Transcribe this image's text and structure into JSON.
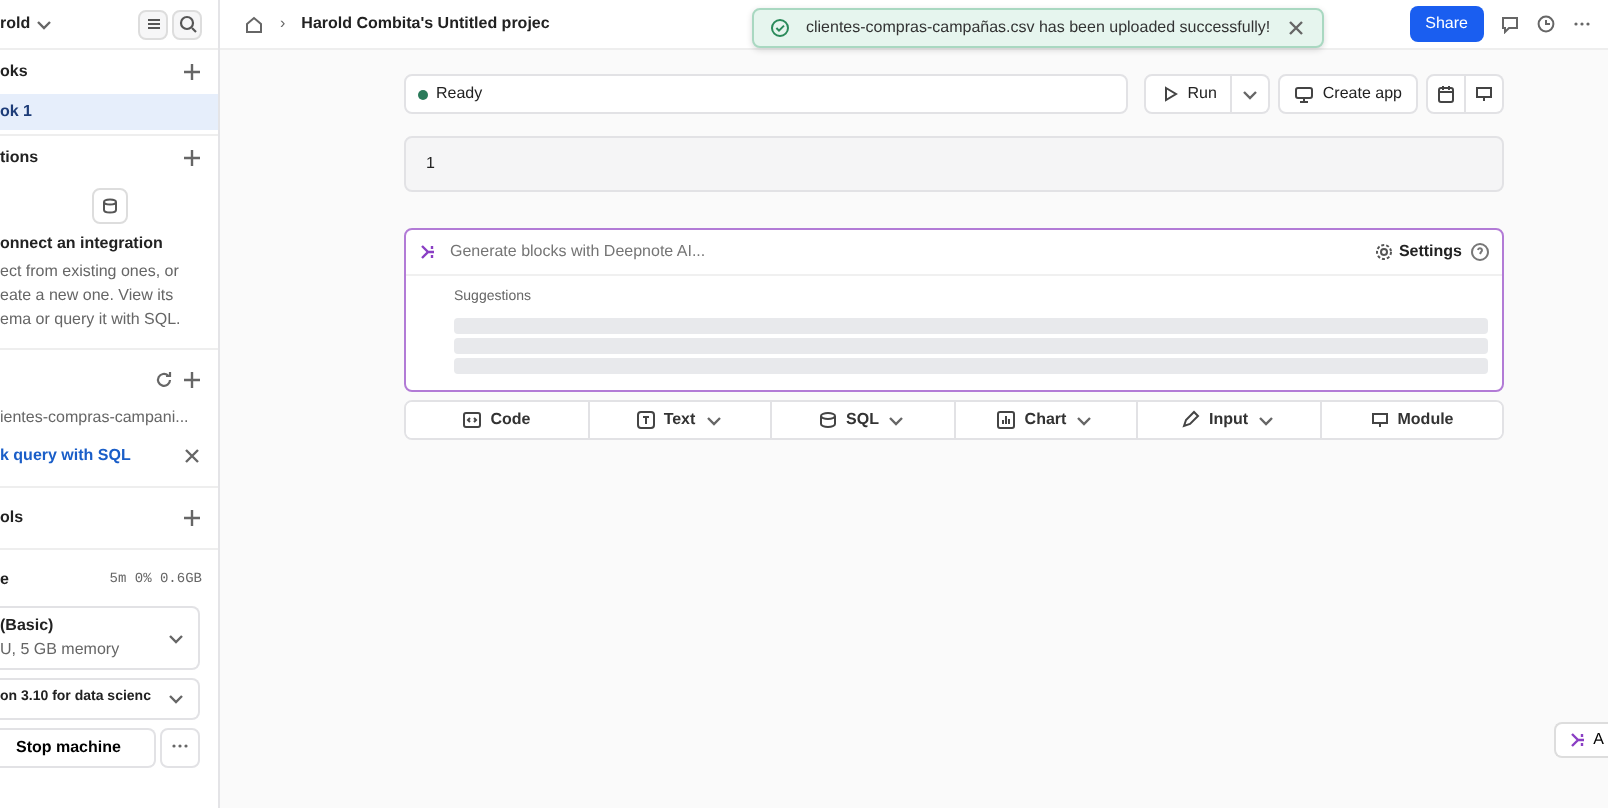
{
  "sidebar": {
    "workspace": "rold",
    "notebooks": {
      "title": "oks",
      "items": [
        {
          "label": "ok 1",
          "selected": true
        }
      ]
    },
    "integrations": {
      "title": "tions",
      "empty_title": "onnect an integration",
      "empty_lines": [
        "ect from existing ones, or",
        "eate a new one. View its",
        "ema or query it with SQL."
      ]
    },
    "files": {
      "items": [
        {
          "name": "ientes-compras-campani..."
        }
      ],
      "action": "k query with SQL"
    },
    "tools": {
      "title": "ols"
    },
    "machine": {
      "title": "e",
      "stats": "5m 0% 0.6GB",
      "spec_title": "(Basic)",
      "spec_detail": "U, 5 GB memory",
      "environment": "on 3.10 for data scienc",
      "stop": "Stop machine"
    }
  },
  "header": {
    "separator": "›",
    "breadcrumb": "Harold Combita's Untitled projec",
    "share": "Share"
  },
  "toast": {
    "message": "clientes-compras-campañas.csv has been uploaded successfully!"
  },
  "toolbar": {
    "status": "Ready",
    "run": "Run",
    "create_app": "Create app"
  },
  "cells": [
    {
      "kind": "code",
      "text": "1"
    }
  ],
  "ai_block": {
    "placeholder": "Generate blocks with Deepnote AI...",
    "settings": "Settings",
    "suggestions_label": "Suggestions"
  },
  "add_blocks": [
    {
      "label": "Code",
      "dropdown": false,
      "kind": "code"
    },
    {
      "label": "Text",
      "dropdown": true,
      "kind": "text"
    },
    {
      "label": "SQL",
      "dropdown": true,
      "kind": "sql"
    },
    {
      "label": "Chart",
      "dropdown": true,
      "kind": "chart"
    },
    {
      "label": "Input",
      "dropdown": true,
      "kind": "input"
    },
    {
      "label": "Module",
      "dropdown": false,
      "kind": "module"
    }
  ],
  "floating": {
    "label": "A"
  }
}
